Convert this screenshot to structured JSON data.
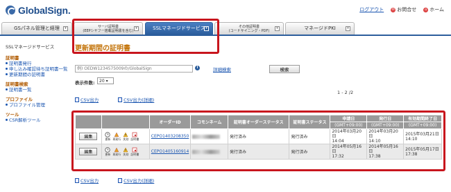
{
  "brand": {
    "name": "GlobalSign."
  },
  "toplinks": {
    "logout": "ログアウト",
    "contact": "お問合せ",
    "home": "ホーム"
  },
  "tabs": [
    {
      "label": "GSパネル管理と経理"
    },
    {
      "label": "サーバ証明書\n(EEPシヤフー搭載証明書を含む)"
    },
    {
      "label": "SSLマネージドサービス"
    },
    {
      "label": "その他証明書\n(コードサイニング・PDF)"
    },
    {
      "label": "マネージドPKI"
    }
  ],
  "sidebar": {
    "heading": "SSLマネージドサービス",
    "sections": [
      {
        "title": "証明書",
        "items": [
          "証明書発行",
          "申し込み確認待ち証明書一覧",
          "更新期間の証明書"
        ]
      },
      {
        "title": "証明書検索",
        "items": [
          "証明書一覧"
        ]
      },
      {
        "title": "プロファイル",
        "items": [
          "プロファイル管理"
        ]
      },
      {
        "title": "ツール",
        "items": [
          "CSR解析ツール"
        ]
      }
    ]
  },
  "main": {
    "title": "更新期間の証明書",
    "search_placeholder": "例) OEDW1234575009の/GlobalSign",
    "advanced_search": "詳細検索",
    "search_button": "検索",
    "count_label": "表示件数:",
    "count_value": "20",
    "page_info": "1 - 2 /2",
    "csv": "CSV出力",
    "csv_detail": "CSV出力(詳細)"
  },
  "table": {
    "headers": {
      "order_id": "オーダーID",
      "common_name": "コモンネーム",
      "order_status": "証明書オーダーステータス",
      "cert_status": "証明書ステータス",
      "applied": "申請日",
      "issued": "発行日",
      "expires": "有効期間終了日",
      "tz": "(GMT+09:00)"
    },
    "actions": {
      "edit": "編集",
      "renew": "更新",
      "reissue": "再発行",
      "revoke": "失効",
      "cert": "証明書"
    },
    "rows": [
      {
        "order_id": "CEPO1403208350",
        "order_status": "発行済み",
        "cert_status": "発行済み",
        "applied_date": "2014年03月20日",
        "applied_time": "14:04",
        "issued_date": "2014年03月20日",
        "issued_time": "14:10",
        "expires_date": "2015年03月21日",
        "expires_time": "14:10"
      },
      {
        "order_id": "CEPO1405160914",
        "order_status": "発行済み",
        "cert_status": "発行済み",
        "applied_date": "2014年05月16日",
        "applied_time": "17:32",
        "issued_date": "2014年05月16日",
        "issued_time": "17:38",
        "expires_date": "2015年05月17日",
        "expires_time": "17:38"
      }
    ]
  }
}
